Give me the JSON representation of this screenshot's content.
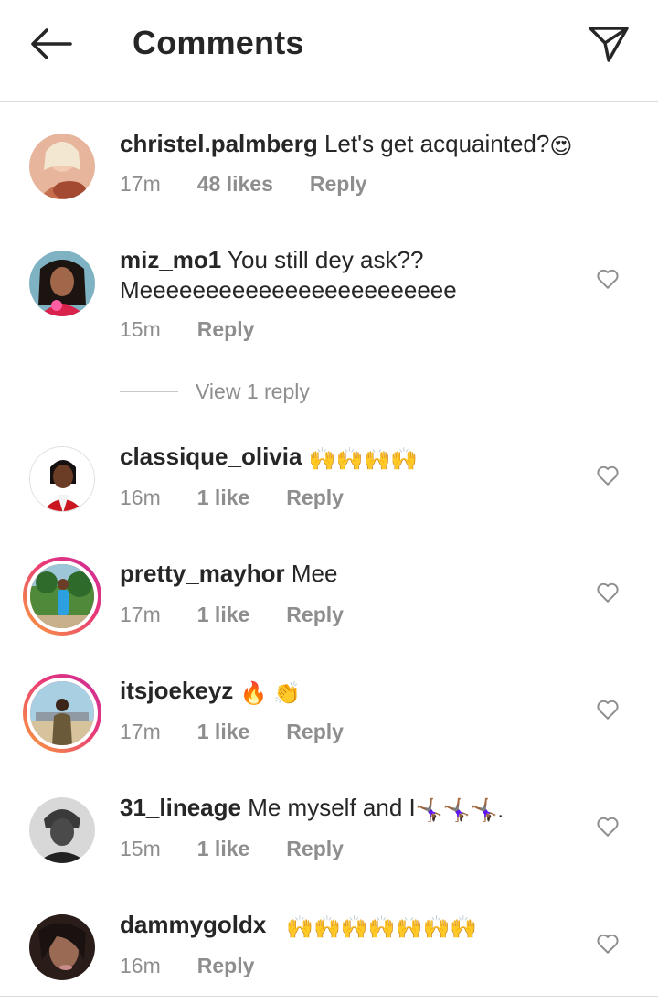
{
  "header": {
    "title": "Comments"
  },
  "comments": [
    {
      "username": "christel.palmberg",
      "text": "Let's get acquainted?",
      "emoji": "😍",
      "time": "17m",
      "likes": "48 likes",
      "reply": "Reply",
      "has_heart": false
    },
    {
      "username": "miz_mo1",
      "text": "You still dey ask?? Meeeeeeeeeeeeeeeeeeeeeeee",
      "emoji": "",
      "time": "15m",
      "likes": "",
      "reply": "Reply",
      "has_heart": true
    },
    {
      "username": "classique_olivia",
      "text": "",
      "emoji": "🙌🙌🙌🙌",
      "time": "16m",
      "likes": "1 like",
      "reply": "Reply",
      "has_heart": true
    },
    {
      "username": "pretty_mayhor",
      "text": "Mee",
      "emoji": "",
      "time": "17m",
      "likes": "1 like",
      "reply": "Reply",
      "has_heart": true
    },
    {
      "username": "itsjoekeyz",
      "text": "",
      "emoji": "🔥 👏",
      "time": "17m",
      "likes": "1 like",
      "reply": "Reply",
      "has_heart": true
    },
    {
      "username": "31_lineage",
      "text": "Me myself and I",
      "emoji": "🤸🏾‍♀️🤸🏾‍♀️🤸🏾‍♀️.",
      "time": "15m",
      "likes": "1 like",
      "reply": "Reply",
      "has_heart": true
    },
    {
      "username": "dammygoldx_",
      "text": "",
      "emoji": "🙌🙌🙌🙌🙌🙌🙌",
      "time": "16m",
      "likes": "",
      "reply": "Reply",
      "has_heart": true
    }
  ],
  "view_replies": {
    "label": "View 1 reply"
  },
  "colors": {
    "text": "#262626",
    "muted": "#8e8e8e",
    "divider": "#dbdbdb",
    "story_ring": "#e8367a"
  }
}
